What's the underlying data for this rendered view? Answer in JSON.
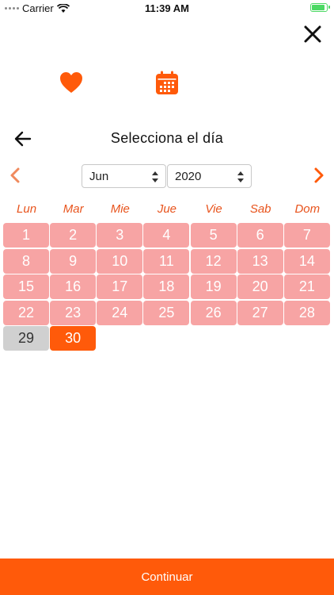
{
  "status_bar": {
    "carrier": "Carrier",
    "time": "11:39 AM"
  },
  "header": {
    "title": "Selecciona el día"
  },
  "selectors": {
    "month": "Jun",
    "year": "2020"
  },
  "weekdays": [
    "Lun",
    "Mar",
    "Mie",
    "Jue",
    "Vie",
    "Sab",
    "Dom"
  ],
  "calendar": {
    "days": [
      "1",
      "2",
      "3",
      "4",
      "5",
      "6",
      "7",
      "8",
      "9",
      "10",
      "11",
      "12",
      "13",
      "14",
      "15",
      "16",
      "17",
      "18",
      "19",
      "20",
      "21",
      "22",
      "23",
      "24",
      "25",
      "26",
      "27",
      "28",
      "29",
      "30"
    ],
    "today": "29",
    "selected": "30"
  },
  "footer": {
    "continue_label": "Continuar"
  },
  "colors": {
    "accent": "#ff5a0a",
    "disabled_day": "#f7a4a4",
    "today": "#d0d0d0",
    "weekday_text": "#e8541d"
  }
}
